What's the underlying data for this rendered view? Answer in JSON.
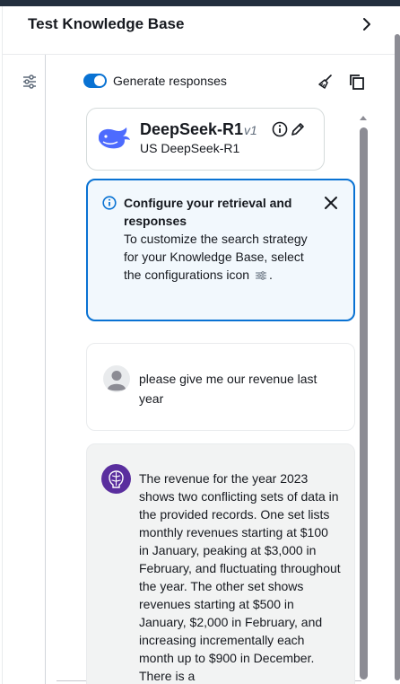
{
  "panel": {
    "title": "Test Knowledge Base"
  },
  "toolbar": {
    "generate_label": "Generate responses",
    "generate_enabled": true
  },
  "model": {
    "name": "DeepSeek-R1",
    "version": "v1",
    "region_label": "US DeepSeek-R1"
  },
  "alert": {
    "title": "Configure your retrieval and responses",
    "text_before": "To customize the search strategy for your Knowledge Base, select the configurations icon",
    "text_after": "."
  },
  "chat": {
    "user_message": "please give me our revenue last year",
    "response": "The revenue for the year 2023 shows two conflicting sets of data in the provided records. One set lists monthly revenues starting at $100 in January, peaking at $3,000 in February, and fluctuating throughout the year. The other set shows revenues starting at $500 in January, $2,000 in February, and increasing incrementally each month up to $900 in December. There is a"
  },
  "colors": {
    "accent": "#0972d3",
    "alert_bg": "#f2f8fd",
    "response_bg": "#f2f3f3"
  },
  "icons": {
    "expand": "chevron-right-icon",
    "config": "settings-sliders-icon",
    "clear": "broom-icon",
    "copy": "copy-icon",
    "info": "info-circle-icon",
    "edit": "pencil-icon",
    "close": "close-icon",
    "model_logo": "deepseek-whale-icon",
    "user_avatar": "user-avatar-icon",
    "assistant_avatar": "assistant-brain-icon"
  }
}
